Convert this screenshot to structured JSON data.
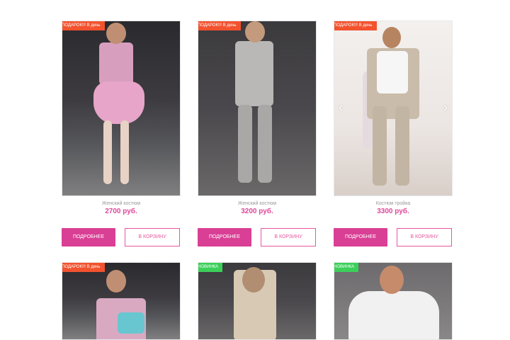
{
  "products": [
    {
      "badge": "ПОДАРОК!!! В день",
      "badge_type": "sale",
      "title": "Женский костюм",
      "price": "2700 руб.",
      "buy_label": "ПОДРОБНЕЕ",
      "cart_label": "В КОРЗИНУ",
      "accent": "#e7a6c9"
    },
    {
      "badge": "ПОДАРОК!!! В день",
      "badge_type": "sale",
      "title": "Женский костюм",
      "price": "3200 руб.",
      "buy_label": "ПОДРОБНЕЕ",
      "cart_label": "В КОРЗИНУ",
      "accent": "#b9b8b6"
    },
    {
      "badge": "ПОДАРОК!!! В день",
      "badge_type": "sale",
      "title": "Костюм тройка",
      "price": "3300 руб.",
      "buy_label": "ПОДРОБНЕЕ",
      "cart_label": "В КОРЗИНУ",
      "accent": "#c9bcaa",
      "has_arrows": true
    },
    {
      "badge": "ПОДАРОК!!! В день",
      "badge_type": "sale",
      "accent": "#d9a9c2"
    },
    {
      "badge": "НОВИНКА",
      "badge_type": "new",
      "accent": "#d8c9b4"
    },
    {
      "badge": "НОВИНКА",
      "badge_type": "new",
      "accent": "#f1f1f1"
    }
  ],
  "colors": {
    "price": "#e0489a",
    "button_primary": "#d93f95",
    "badge_sale": "#f2522e",
    "badge_new": "#3ccf5a"
  }
}
